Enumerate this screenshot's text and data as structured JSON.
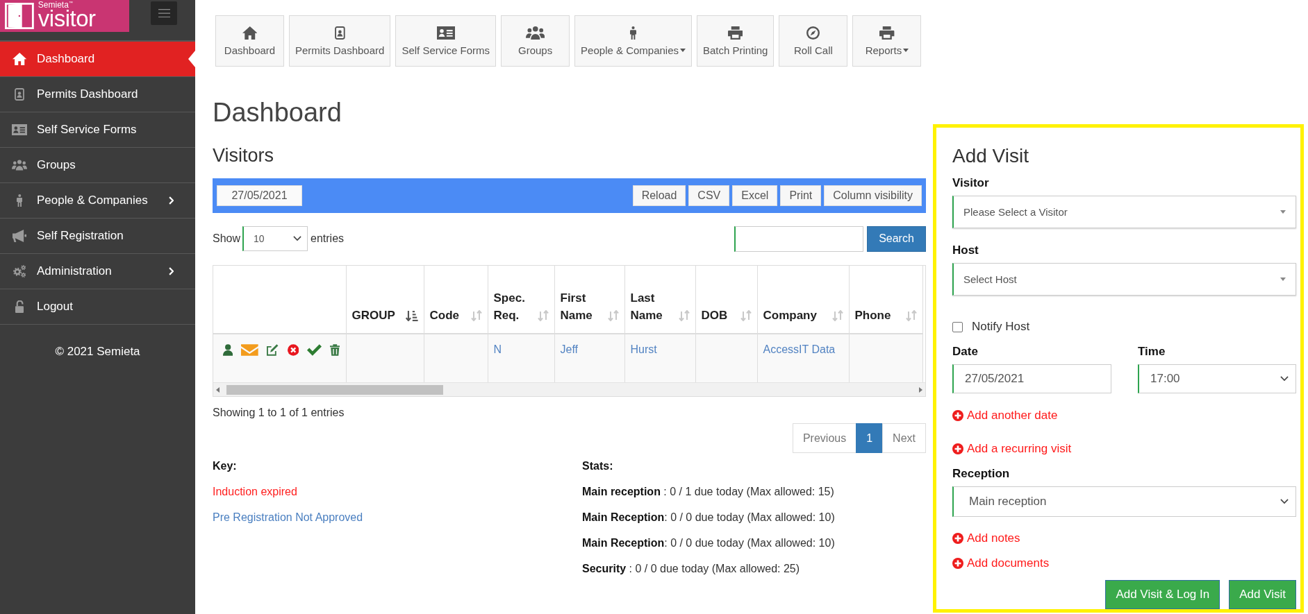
{
  "sidebar": {
    "logo": {
      "brand": "Semieta$^{™}$",
      "product": "visitor"
    },
    "items": [
      {
        "label": "Dashboard",
        "selected": true,
        "submenu": false
      },
      {
        "label": "Permits Dashboard",
        "selected": false,
        "submenu": false
      },
      {
        "label": "Self Service Forms",
        "selected": false,
        "submenu": false
      },
      {
        "label": "Groups",
        "selected": false,
        "submenu": false
      },
      {
        "label": "People & Companies",
        "selected": false,
        "submenu": true
      },
      {
        "label": "Self Registration",
        "selected": false,
        "submenu": false
      },
      {
        "label": "Administration",
        "selected": false,
        "submenu": true
      },
      {
        "label": "Logout",
        "selected": false,
        "submenu": false
      }
    ],
    "footer": "© 2021 Semieta"
  },
  "toolbar": [
    {
      "label": "Dashboard",
      "dropdown": false
    },
    {
      "label": "Permits Dashboard",
      "dropdown": false
    },
    {
      "label": "Self Service Forms",
      "dropdown": false
    },
    {
      "label": "Groups",
      "dropdown": false
    },
    {
      "label": "People & Companies",
      "dropdown": true
    },
    {
      "label": "Batch Printing",
      "dropdown": false
    },
    {
      "label": "Roll Call",
      "dropdown": false
    },
    {
      "label": "Reports",
      "dropdown": true
    }
  ],
  "page_title": "Dashboard",
  "visitors": {
    "title": "Visitors",
    "date": "27/05/2021",
    "buttons": [
      "Reload",
      "CSV",
      "Excel",
      "Print",
      "Column visibility"
    ],
    "length": {
      "before": "Show",
      "value": "10",
      "after": "entries"
    },
    "search": {
      "button": "Search"
    },
    "table": {
      "columns": [
        {
          "label": "GROUP",
          "sorted": true
        },
        {
          "label": "Code",
          "sorted": false
        },
        {
          "label": "Spec. Req.",
          "sorted": false
        },
        {
          "label": "First Name",
          "sorted": false
        },
        {
          "label": "Last Name",
          "sorted": false
        },
        {
          "label": "DOB",
          "sorted": false
        },
        {
          "label": "Company",
          "sorted": false
        },
        {
          "label": "Phone",
          "sorted": false
        }
      ],
      "rows": [
        {
          "cells": [
            null,
            null,
            "N",
            "Jeff",
            "Hurst",
            null,
            "AccessIT Data",
            null
          ]
        }
      ]
    },
    "info": "Showing 1 to 1 of 1 entries",
    "pagination": {
      "previous": {
        "label": "Previous",
        "disabled": true
      },
      "pages": [
        {
          "label": "1",
          "selected": true
        }
      ],
      "next": {
        "label": "Next",
        "disabled": true
      }
    }
  },
  "key": {
    "title": "Key:",
    "items": [
      {
        "label": "Induction expired",
        "color": "#ff2020"
      },
      {
        "label": "Pre Registration Not Approved",
        "color": "#4a7fc0"
      }
    ]
  },
  "stats": {
    "title": "Stats:",
    "items": [
      "**Main reception** : 0 / 1 due today (Max allowed: 15)",
      "**Main Reception**: 0 / 0 due today (Max allowed: 10)",
      "**Main Reception**: 0 / 0 due today (Max allowed: 10)",
      "**Security** : 0 / 0 due today (Max allowed: 25)"
    ]
  },
  "add_visit": {
    "title": "Add Visit",
    "visitor": {
      "label": "Visitor",
      "placeholder": "Please Select a Visitor"
    },
    "host": {
      "label": "Host",
      "placeholder": "Select Host"
    },
    "notify_host": {
      "label": "Notify Host",
      "checked": false
    },
    "date": {
      "label": "Date",
      "value": "27/05/2021"
    },
    "time": {
      "label": "Time",
      "value": "17:00"
    },
    "date_links": [
      "Add another date",
      "Add a recurring visit"
    ],
    "reception": {
      "label": "Reception",
      "value": "Main reception"
    },
    "extra_links": [
      "Add notes",
      "Add documents"
    ],
    "buttons": [
      "Add Visit & Log In",
      "Add Visit"
    ]
  }
}
